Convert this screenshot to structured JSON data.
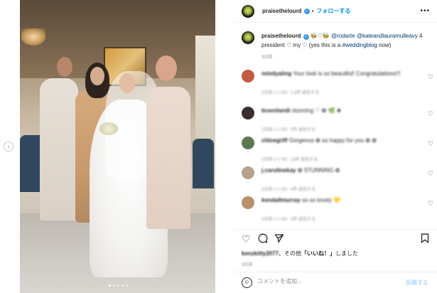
{
  "post": {
    "username": "praisethelourd",
    "follow_label": "フォローする",
    "separator": "•",
    "more_label": "•••"
  },
  "caption": {
    "username": "praisethelourd",
    "text_part1": " 🐝♡🐝 ",
    "mention1": "@rodarte",
    "mention2": "@kateandlauramulleavy",
    "text_part2": " 4 president ♡ my ♡ (yes this is a ",
    "hashtag": "#weddingblog",
    "text_part3": " now)",
    "time": "3日前"
  },
  "comments": [
    {
      "user": "mindyaling",
      "text": "Your look is so beautiful! Congratulations!!!",
      "meta": "2日前  いいね！1,4件  返信する",
      "avatar_color": "#c25b3f"
    },
    {
      "user": "bravolandi",
      "text": "stunning ♡ ✿ 🌿 ❀",
      "meta": "2日前  いいね！5件  返信する",
      "avatar_color": "#3a2f2f"
    },
    {
      "user": "chloegriff",
      "text": "Gorgeous ✿ so happy for you ✿ ✿",
      "meta": "2日前  いいね！22件  返信する",
      "avatar_color": "#5b7a52"
    },
    {
      "user": "j.carolinekay",
      "text": "✿ STUNNING ✿",
      "meta": "2日前  いいね！4件  返信する",
      "avatar_color": "#b8a08a"
    },
    {
      "user": "kendallmurray",
      "text": "so so lovely 💛",
      "meta": "2日前  いいね！3件  返信する",
      "avatar_color": "#b7916c"
    }
  ],
  "likes": {
    "user": "kenzkitty2077",
    "suffix": "、その他",
    "quote": "「いいね！」",
    "end": "しました"
  },
  "ago": "3日前",
  "compose": {
    "placeholder": "コメントを追加...",
    "post_label": "投稿する"
  },
  "icons": {
    "heart": "heart-icon",
    "comment": "comment-icon",
    "share": "share-icon",
    "save": "bookmark-icon",
    "emoji": "emoji-icon"
  },
  "colors": {
    "accent": "#0095f6",
    "verified": "#3897f0",
    "link": "#00376b",
    "muted": "#8e8e8e"
  }
}
